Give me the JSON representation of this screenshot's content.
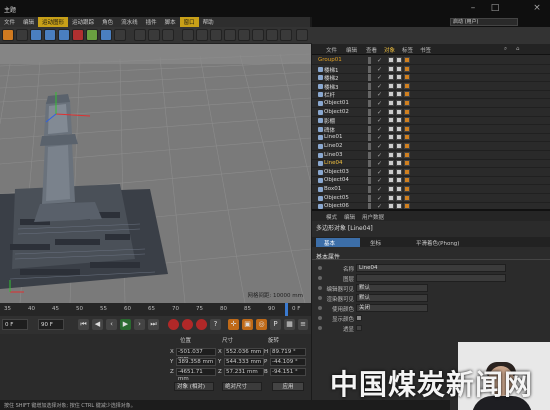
{
  "window": {
    "title": "主题",
    "layout_label": "启动 (用户)"
  },
  "menu": [
    {
      "label": "文件"
    },
    {
      "label": "编辑"
    },
    {
      "label": "运动图形"
    },
    {
      "label": "运动跟踪"
    },
    {
      "label": "角色"
    },
    {
      "label": "流水线"
    },
    {
      "label": "插件"
    },
    {
      "label": "脚本"
    },
    {
      "label": "窗口"
    },
    {
      "label": "帮助"
    }
  ],
  "viewport": {
    "info": "网格间距: 10000 mm"
  },
  "object_manager": {
    "tabs": [
      "文件",
      "编辑",
      "查看",
      "对象",
      "标签",
      "书签"
    ],
    "active_tab": "对象",
    "objects": [
      {
        "name": "Group01",
        "group": true
      },
      {
        "name": "楼梯1"
      },
      {
        "name": "楼梯2"
      },
      {
        "name": "楼梯3"
      },
      {
        "name": "栏杆"
      },
      {
        "name": "Object01"
      },
      {
        "name": "Object02"
      },
      {
        "name": "影棚"
      },
      {
        "name": "碑体"
      },
      {
        "name": "Line01"
      },
      {
        "name": "Line02"
      },
      {
        "name": "Line03"
      },
      {
        "name": "Line04",
        "selected": true
      },
      {
        "name": "Object03"
      },
      {
        "name": "Object04"
      },
      {
        "name": "Box01"
      },
      {
        "name": "Object05"
      },
      {
        "name": "Object06"
      }
    ]
  },
  "attributes": {
    "tabs": [
      "模式",
      "编辑",
      "用户数据"
    ],
    "object_label": "多边形对象 [Line04]",
    "subtabs": [
      "基本",
      "坐标",
      "平滑着色(Phong)"
    ],
    "active_subtab": "基本",
    "section": "基本属性",
    "fields": [
      {
        "label": "名称",
        "value": "Line04",
        "kind": "text"
      },
      {
        "label": "图层",
        "value": "",
        "kind": "text"
      },
      {
        "label": "编辑器可见",
        "value": "默认",
        "kind": "dropdown"
      },
      {
        "label": "渲染器可见",
        "value": "默认",
        "kind": "dropdown"
      },
      {
        "label": "使用颜色",
        "value": "关闭",
        "kind": "dropdown"
      },
      {
        "label": "显示颜色",
        "value": "",
        "kind": "text"
      },
      {
        "label": "透显",
        "value": "",
        "kind": "check"
      }
    ]
  },
  "timeline": {
    "ticks": [
      "35",
      "40",
      "45",
      "50",
      "55",
      "60",
      "65",
      "70",
      "75",
      "80",
      "85",
      "90"
    ],
    "current_frame_label": "0 F"
  },
  "playback": {
    "start": "0 F",
    "end": "90 F"
  },
  "coordinates": {
    "headers": {
      "position": "位置",
      "size": "尺寸",
      "rotation": "旋转"
    },
    "rows": [
      {
        "axis": "X",
        "position": "-501.037 mm",
        "size_axis": "X",
        "size": "552.036 mm",
        "rot_axis": "H",
        "rotation": "89.719 °"
      },
      {
        "axis": "Y",
        "position": "389.358 mm",
        "size_axis": "Y",
        "size": "544.333 mm",
        "rot_axis": "P",
        "rotation": "-44.109 °"
      },
      {
        "axis": "Z",
        "position": "-4651.71 mm",
        "size_axis": "Z",
        "size": "57.231 mm",
        "rot_axis": "B",
        "rotation": "-94.151 °"
      }
    ],
    "mode_dropdown": "对象 (相对)",
    "size_dropdown": "绝对尺寸",
    "apply_label": "应用"
  },
  "status": "按住 SHIFT 键增加选择对象; 按住 CTRL 键减少选择对象。",
  "watermark": "中国煤炭新闻网",
  "colors": {
    "accent_blue": "#3c6ea8",
    "group_orange": "#e2a020",
    "selected_yellow": "#f0c040",
    "viewport_gray": "#7e7e7e"
  }
}
